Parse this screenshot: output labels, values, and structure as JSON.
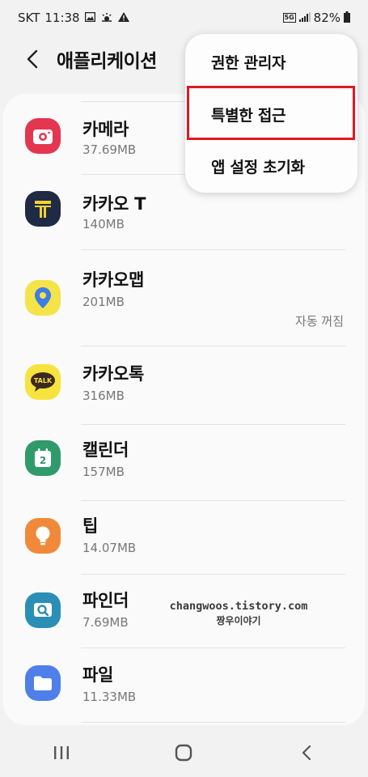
{
  "status_bar": {
    "carrier": "SKT",
    "time": "11:38",
    "network": "5G",
    "battery": "82%"
  },
  "header": {
    "title": "애플리케이션"
  },
  "apps": [
    {
      "name": "카메라",
      "size": "37.69MB",
      "status": "",
      "icon": "camera-icon",
      "color": "#e33650"
    },
    {
      "name": "카카오 T",
      "size": "140MB",
      "status": "",
      "icon": "kakao-t-icon",
      "color": "#1f2a44"
    },
    {
      "name": "카카오맵",
      "size": "201MB",
      "status": "자동 꺼짐",
      "icon": "kakao-map-icon",
      "color": "#f5e34a"
    },
    {
      "name": "카카오톡",
      "size": "316MB",
      "status": "",
      "icon": "kakaotalk-icon",
      "color": "#f7e33d"
    },
    {
      "name": "캘린더",
      "size": "157MB",
      "status": "",
      "icon": "calendar-icon",
      "color": "#2f9a6a"
    },
    {
      "name": "팁",
      "size": "14.07MB",
      "status": "",
      "icon": "lightbulb-icon",
      "color": "#f08a3a"
    },
    {
      "name": "파인더",
      "size": "7.69MB",
      "status": "",
      "icon": "finder-icon",
      "color": "#2b8fb5"
    },
    {
      "name": "파일",
      "size": "11.33MB",
      "status": "",
      "icon": "folder-icon",
      "color": "#4f7fe8"
    }
  ],
  "menu": {
    "items": [
      "권한 관리자",
      "특별한 접근",
      "앱 설정 초기화"
    ],
    "highlight_color": "#e0191f"
  },
  "watermark": {
    "url": "changwoos.tistory.com",
    "name": "짱우이야기"
  }
}
